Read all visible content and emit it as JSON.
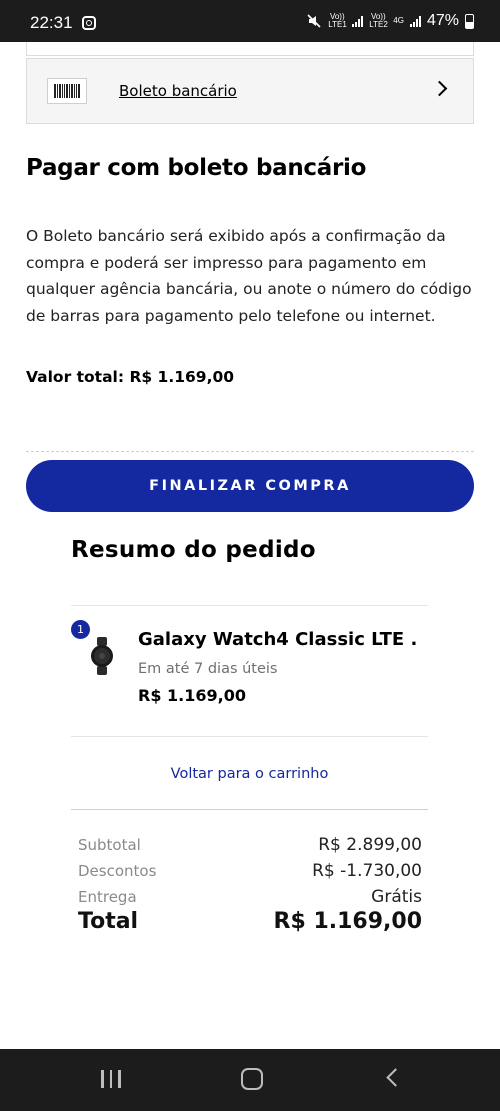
{
  "status_bar": {
    "time": "22:31",
    "sim1": "Vo)) LTE1",
    "sim2": "Vo)) LTE2",
    "network": "4G",
    "battery": "47%"
  },
  "payment_option": {
    "icon": "barcode-icon",
    "label": "Boleto bancário"
  },
  "payment_section": {
    "title": "Pagar com boleto bancário",
    "description": "O Boleto bancário será exibido após a confirmação da compra e poderá ser impresso para pagamento em qualquer agência bancária, ou anote o número do código de barras para pagamento pelo telefone ou internet.",
    "total_line": "Valor total: R$ 1.169,00"
  },
  "finalize_button": "FINALIZAR COMPRA",
  "order_summary": {
    "title": "Resumo do pedido",
    "item": {
      "quantity": "1",
      "name": "Galaxy Watch4 Classic LTE ...",
      "delivery": "Em até 7 dias úteis",
      "price": "R$ 1.169,00"
    },
    "back_link": "Voltar para o carrinho",
    "totals": {
      "subtotal_label": "Subtotal",
      "subtotal_value": "R$ 2.899,00",
      "discount_label": "Descontos",
      "discount_value": "R$ -1.730,00",
      "delivery_label": "Entrega",
      "delivery_value": "Grátis",
      "total_label": "Total",
      "total_value": "R$ 1.169,00"
    }
  },
  "colors": {
    "accent": "#1428a0",
    "system_bar": "#1c1c1c"
  }
}
